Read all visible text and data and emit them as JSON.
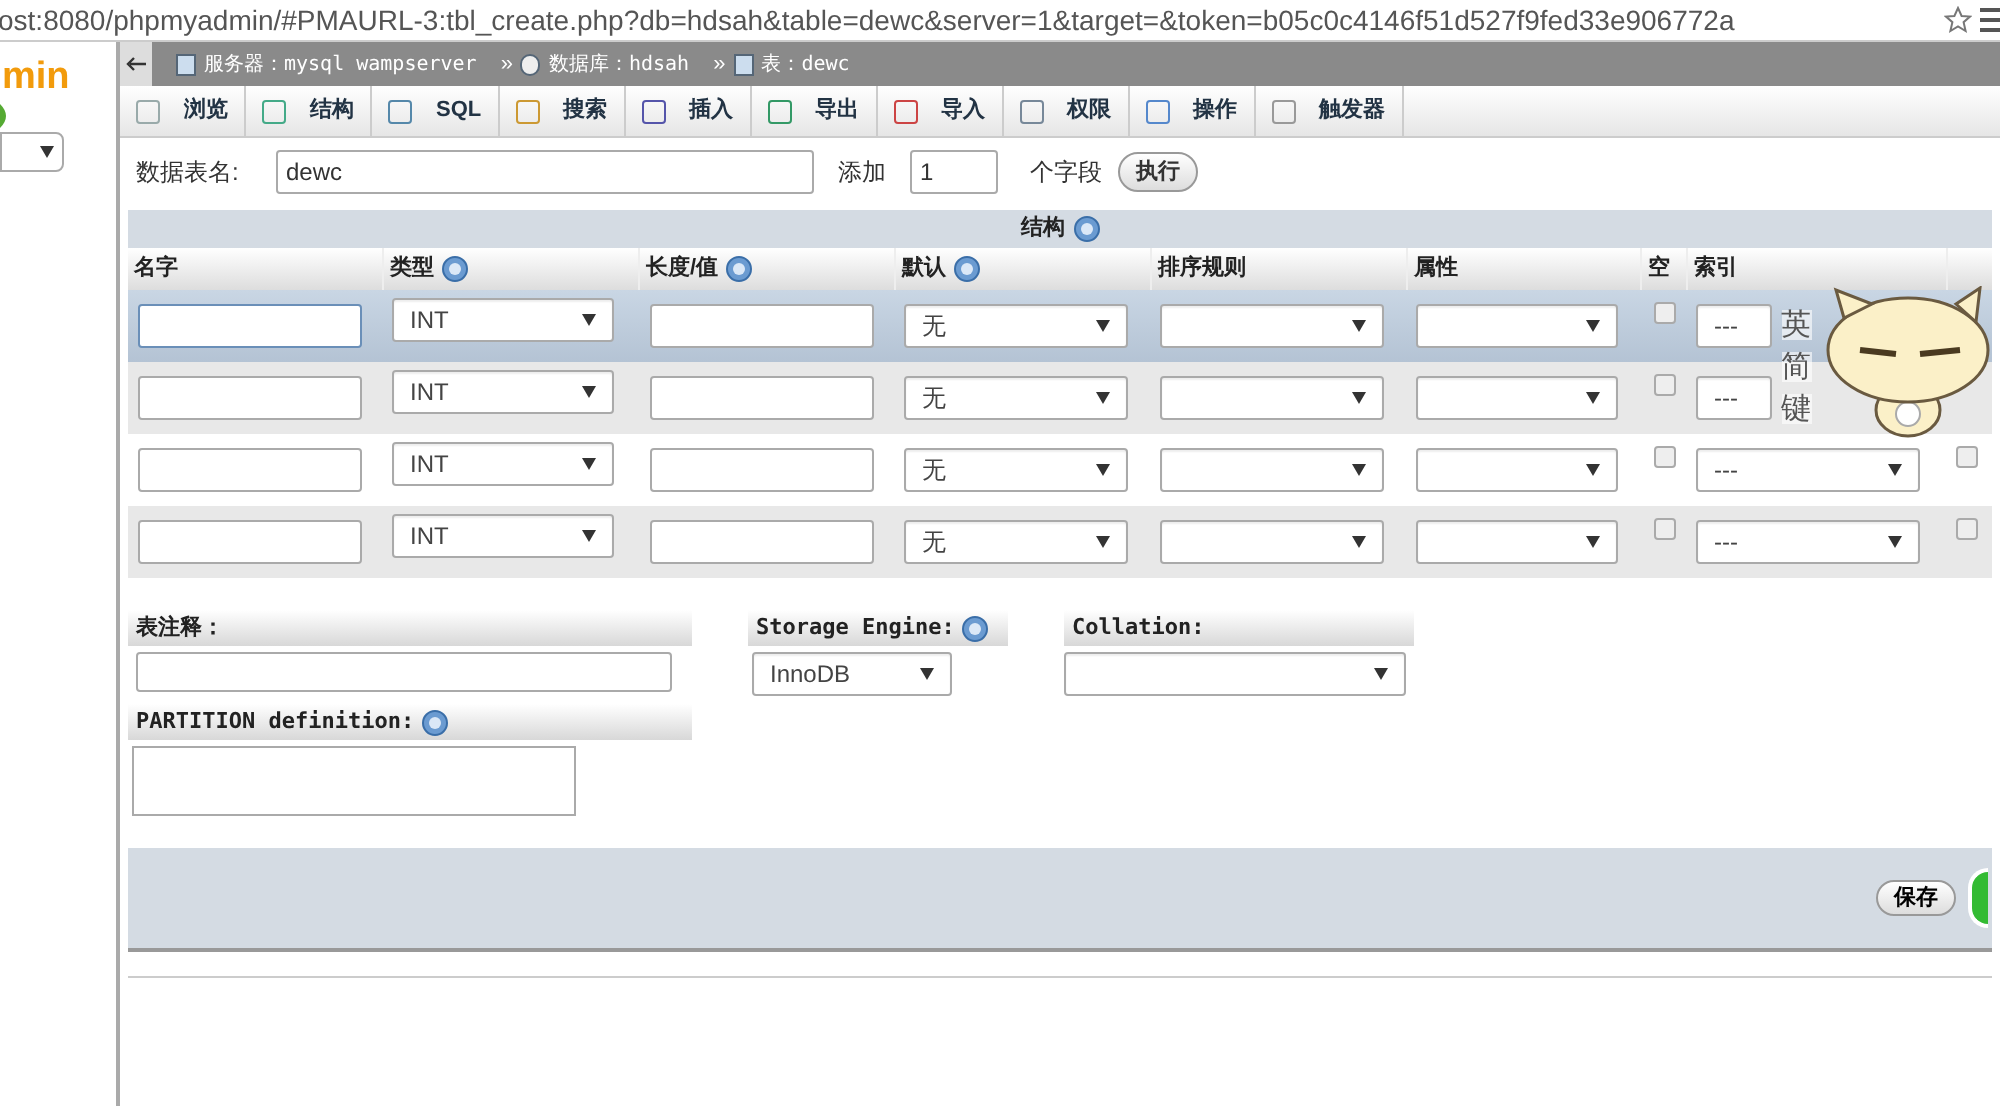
{
  "browser": {
    "url": "ost:8080/phpmyadmin/#PMAURL-3:tbl_create.php?db=hdsah&table=dewc&server=1&target=&token=b05c0c4146f51d527f9fed33e906772a"
  },
  "sidebar": {
    "logo": "min"
  },
  "breadcrumb": [
    {
      "kind": "server",
      "label": "服务器：mysql wampserver"
    },
    {
      "kind": "database",
      "label": "数据库：hdsah"
    },
    {
      "kind": "table",
      "label": "表：dewc"
    }
  ],
  "breadcrumb_separator": "»",
  "tabs": [
    {
      "kind": "browse",
      "label": "浏览"
    },
    {
      "kind": "structure",
      "label": "结构"
    },
    {
      "kind": "sql",
      "label": "SQL"
    },
    {
      "kind": "search",
      "label": "搜索"
    },
    {
      "kind": "insert",
      "label": "插入"
    },
    {
      "kind": "export",
      "label": "导出"
    },
    {
      "kind": "import",
      "label": "导入"
    },
    {
      "kind": "privileges",
      "label": "权限"
    },
    {
      "kind": "operations",
      "label": "操作"
    },
    {
      "kind": "triggers",
      "label": "触发器"
    }
  ],
  "table_name": {
    "label": "数据表名:",
    "value": "dewc"
  },
  "add_fields": {
    "label": "添加",
    "value": "1",
    "suffix": "个字段",
    "button": "执行"
  },
  "structure": {
    "title": "结构",
    "columns": [
      {
        "label": "名字",
        "help": false
      },
      {
        "label": "类型",
        "help": true
      },
      {
        "label": "长度/值",
        "help": true
      },
      {
        "label": "默认",
        "help": true
      },
      {
        "label": "排序规则",
        "help": false
      },
      {
        "label": "属性",
        "help": false
      },
      {
        "label": "空",
        "help": false
      },
      {
        "label": "索引",
        "help": false
      }
    ],
    "rows": [
      {
        "highlighted": true,
        "type": "INT",
        "default": "无",
        "null": false,
        "index": "---"
      },
      {
        "highlighted": false,
        "type": "INT",
        "default": "无",
        "null": false,
        "index": "---"
      },
      {
        "highlighted": false,
        "type": "INT",
        "default": "无",
        "null": false,
        "index": "---",
        "last_checked": false
      },
      {
        "highlighted": false,
        "type": "INT",
        "default": "无",
        "null": false,
        "index": "---",
        "last_checked": false
      }
    ]
  },
  "table_comment": {
    "label": "表注释："
  },
  "storage_engine": {
    "label": "Storage Engine:",
    "value": "InnoDB"
  },
  "collation": {
    "label": "Collation:"
  },
  "partition": {
    "label": "PARTITION definition:"
  },
  "save_button": "保存",
  "ime_status": [
    "英",
    "简",
    "键"
  ]
}
